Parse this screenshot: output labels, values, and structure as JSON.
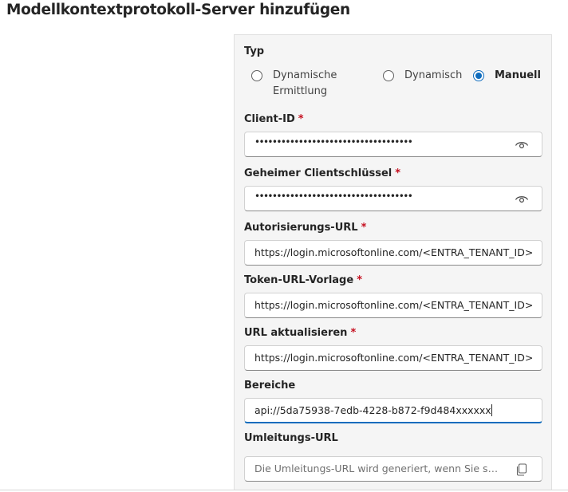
{
  "page": {
    "title": "Modellkontextprotokoll-Server hinzufügen"
  },
  "type_section": {
    "label": "Typ",
    "options": [
      {
        "label": "Dynamische Ermittlung",
        "selected": false
      },
      {
        "label": "Dynamisch",
        "selected": false
      },
      {
        "label": "Manuell",
        "selected": true
      }
    ]
  },
  "required_marker": "*",
  "client_id": {
    "label": "Client-ID",
    "value": "••••••••••••••••••••••••••••••••••••",
    "icon": "eye-icon"
  },
  "client_secret": {
    "label": "Geheimer Clientschlüssel",
    "value": "••••••••••••••••••••••••••••••••••••",
    "icon": "eye-icon"
  },
  "authorization_url": {
    "label": "Autorisierungs-URL",
    "value": "https://login.microsoftonline.com/<ENTRA_TENANT_ID>"
  },
  "token_url_template": {
    "label": "Token-URL-Vorlage",
    "value": "https://login.microsoftonline.com/<ENTRA_TENANT_ID>"
  },
  "refresh_url": {
    "label": "URL aktualisieren",
    "value": "https://login.microsoftonline.com/<ENTRA_TENANT_ID>"
  },
  "scopes": {
    "label": "Bereiche",
    "value": "api://5da75938-7edb-4228-b872-f9d484xxxxxx"
  },
  "redirect_url": {
    "label": "Umleitungs-URL",
    "placeholder": "Die Umleitungs-URL wird generiert, wenn Sie speichern",
    "icon": "copy-icon"
  },
  "colors": {
    "accent": "#0f6cbd",
    "required": "#c50f1f",
    "panel_background": "#f5f5f5"
  }
}
